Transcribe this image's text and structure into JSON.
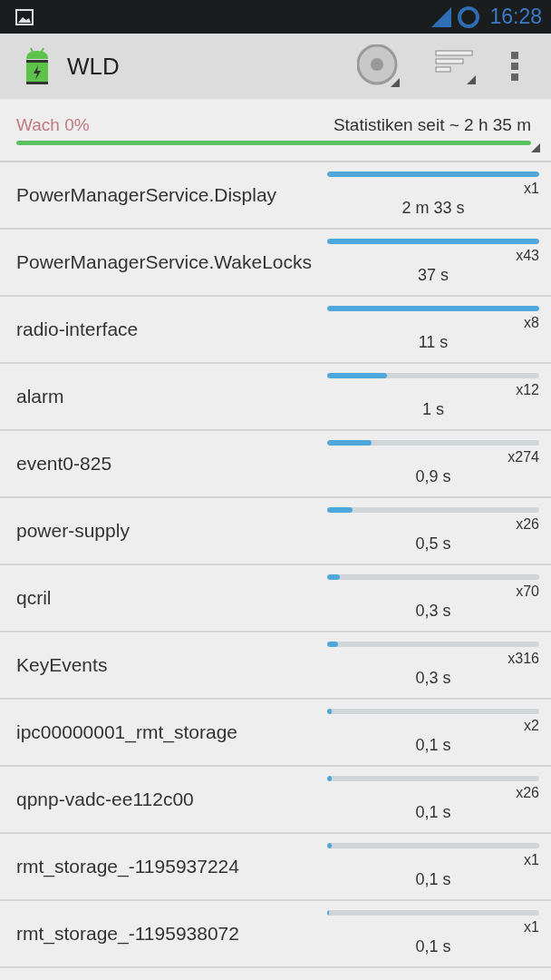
{
  "status_bar": {
    "time": "16:28"
  },
  "app_bar": {
    "title": "WLD"
  },
  "summary": {
    "awake": "Wach 0%",
    "since": "Statistiken seit ~ 2 h 35 m",
    "level": 1.0
  },
  "wakelocks": [
    {
      "name": "PowerManagerService.Display",
      "level": 1.0,
      "count": "x1",
      "duration": "2 m 33 s"
    },
    {
      "name": "PowerManagerService.WakeLocks",
      "level": 1.0,
      "count": "x43",
      "duration": "37 s"
    },
    {
      "name": "radio-interface",
      "level": 1.0,
      "count": "x8",
      "duration": "11 s"
    },
    {
      "name": "alarm",
      "level": 0.28,
      "count": "x12",
      "duration": "1 s"
    },
    {
      "name": "event0-825",
      "level": 0.21,
      "count": "x274",
      "duration": "0,9 s"
    },
    {
      "name": "power-supply",
      "level": 0.12,
      "count": "x26",
      "duration": "0,5 s"
    },
    {
      "name": "qcril",
      "level": 0.06,
      "count": "x70",
      "duration": "0,3 s"
    },
    {
      "name": "KeyEvents",
      "level": 0.05,
      "count": "x316",
      "duration": "0,3 s"
    },
    {
      "name": "ipc00000001_rmt_storage",
      "level": 0.02,
      "count": "x2",
      "duration": "0,1 s"
    },
    {
      "name": "qpnp-vadc-ee112c00",
      "level": 0.02,
      "count": "x26",
      "duration": "0,1 s"
    },
    {
      "name": "rmt_storage_-1195937224",
      "level": 0.02,
      "count": "x1",
      "duration": "0,1 s"
    },
    {
      "name": "rmt_storage_-1195938072",
      "level": 0.01,
      "count": "x1",
      "duration": "0,1 s"
    }
  ]
}
